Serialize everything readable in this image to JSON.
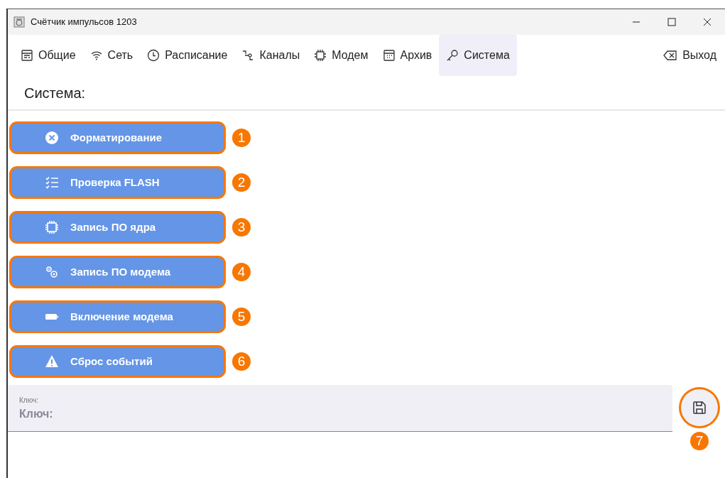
{
  "window": {
    "title": "Счётчик импульсов 1203"
  },
  "tabs": [
    {
      "kind": "general",
      "label": "Общие",
      "selected": false
    },
    {
      "kind": "network",
      "label": "Сеть",
      "selected": false
    },
    {
      "kind": "schedule",
      "label": "Расписание",
      "selected": false
    },
    {
      "kind": "channels",
      "label": "Каналы",
      "selected": false
    },
    {
      "kind": "modem",
      "label": "Модем",
      "selected": false
    },
    {
      "kind": "archive",
      "label": "Архив",
      "selected": false
    },
    {
      "kind": "system",
      "label": "Система",
      "selected": true
    }
  ],
  "exit_button": {
    "label": "Выход"
  },
  "heading": "Система:",
  "actions": [
    {
      "kind": "format",
      "label": "Форматирование",
      "callout": "1"
    },
    {
      "kind": "check",
      "label": "Проверка FLASH",
      "callout": "2"
    },
    {
      "kind": "chip",
      "label": "Запись ПО ядра",
      "callout": "3"
    },
    {
      "kind": "gears",
      "label": "Запись ПО модема",
      "callout": "4"
    },
    {
      "kind": "battery",
      "label": "Включение модема",
      "callout": "5"
    },
    {
      "kind": "warning",
      "label": "Сброс событий",
      "callout": "6"
    }
  ],
  "key_field": {
    "label": "Ключ:",
    "placeholder": "Ключ:"
  },
  "save_button": {
    "callout": "7"
  }
}
